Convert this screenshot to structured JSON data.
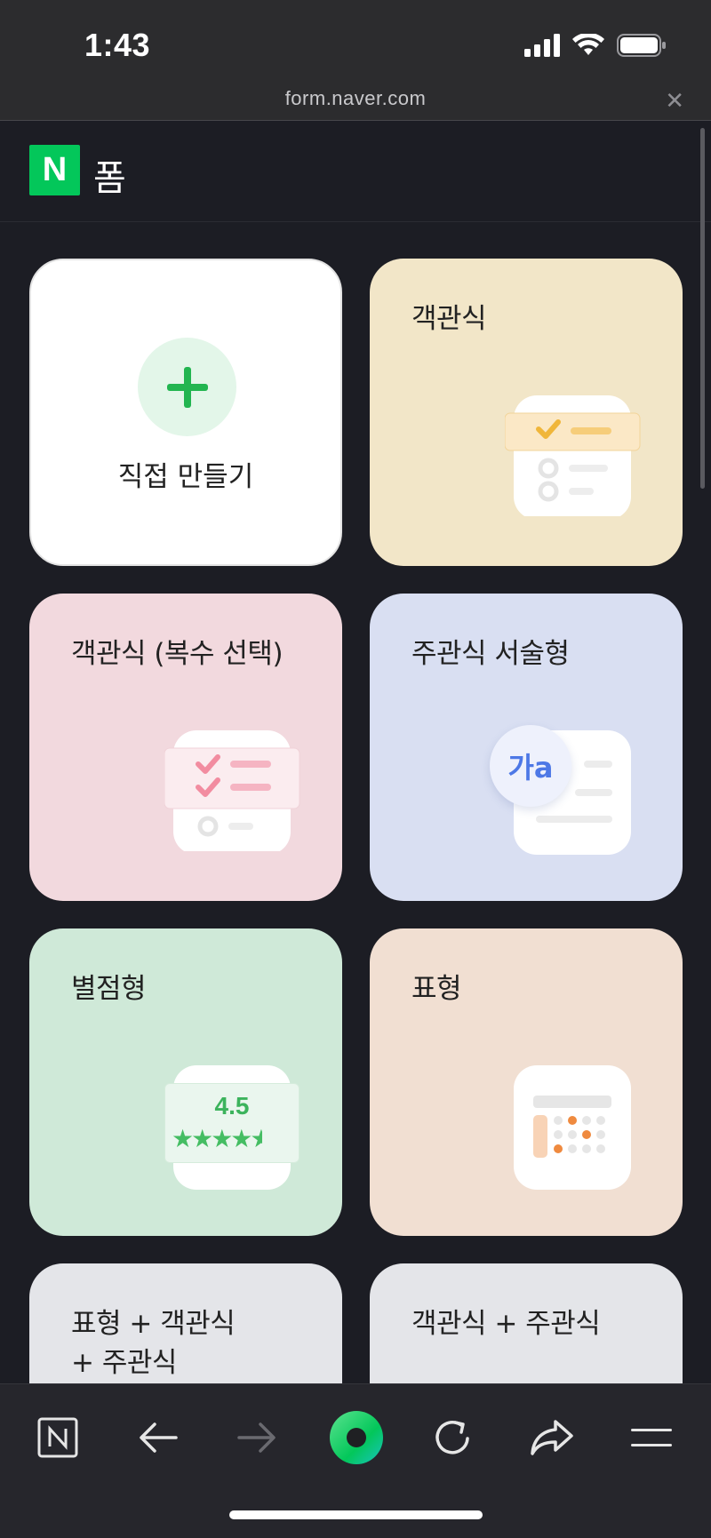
{
  "status_bar": {
    "time": "1:43"
  },
  "browser": {
    "url": "form.naver.com",
    "close_label": "✕"
  },
  "header": {
    "logo_letter": "N",
    "title": "폼"
  },
  "cards": {
    "create": {
      "label": "직접 만들기"
    },
    "multiple_choice": {
      "title": "객관식"
    },
    "multiple_select": {
      "title": "객관식 (복수 선택)"
    },
    "essay": {
      "title": "주관식 서술형",
      "badge": "가a"
    },
    "star_rating": {
      "title": "별점형",
      "rating": "4.5",
      "rating_value": 4.5
    },
    "table": {
      "title": "표형"
    },
    "table_mc_essay": {
      "title_line1": "표형 + 객관식",
      "title_line2": "+ 주관식"
    },
    "mc_essay": {
      "title": "객관식 + 주관식"
    }
  },
  "colors": {
    "naver_green": "#03c75a",
    "card_mc": "#f2e6c8",
    "card_multi": "#f2d9de",
    "card_essay": "#d9dff2",
    "card_star": "#cfe9d8",
    "card_table": "#f1dfd2",
    "card_gray": "#e4e5e9"
  },
  "bottom_nav": {
    "items": [
      "naver-home",
      "back",
      "forward",
      "green-dot",
      "reload",
      "share",
      "menu"
    ]
  }
}
